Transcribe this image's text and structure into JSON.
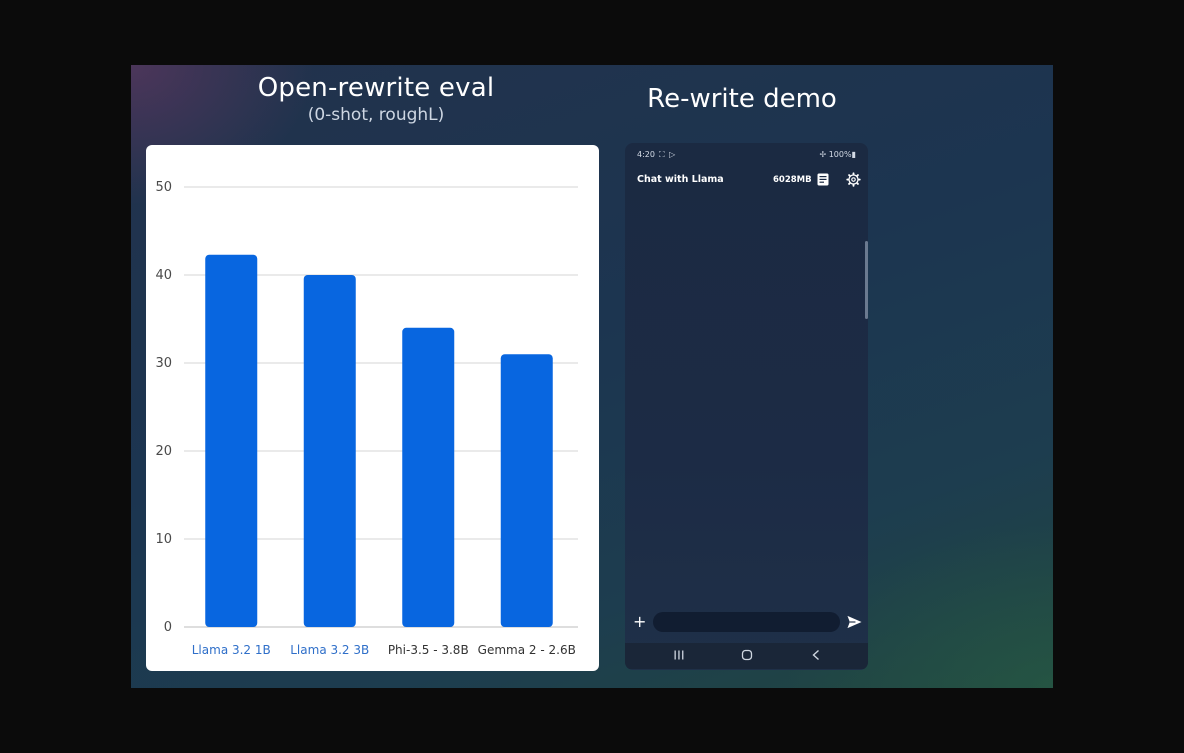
{
  "slide": {
    "left_title": "Open-rewrite eval",
    "left_subtitle": "(0-shot, roughL)",
    "right_title": "Re-write demo"
  },
  "chart_data": {
    "type": "bar",
    "title": "Open-rewrite eval",
    "subtitle": "(0-shot, roughL)",
    "categories": [
      "Llama 3.2 1B",
      "Llama 3.2 3B",
      "Phi-3.5 - 3.8B",
      "Gemma 2 - 2.6B"
    ],
    "values": [
      42.3,
      40.0,
      34.0,
      31.0
    ],
    "ylim": [
      0,
      50
    ],
    "yticks": [
      0,
      10,
      20,
      30,
      40,
      50
    ],
    "xlabel": "",
    "ylabel": "",
    "grid": true,
    "bar_color": "#0866e0",
    "category_label_colors": [
      "#2f6fc9",
      "#2f6fc9",
      "#333333",
      "#333333"
    ]
  },
  "phone": {
    "status": {
      "time": "4:20",
      "icons": "⛶ ▷",
      "battery": "✢ 100%▮"
    },
    "header": {
      "title": "Chat with Llama",
      "memory": "6028MB"
    },
    "input": {
      "plus": "+",
      "placeholder": ""
    },
    "icons": {
      "doc": "document-icon",
      "settings": "gear-icon",
      "send": "send-icon",
      "nav_recent": "recent-apps-icon",
      "nav_home": "home-icon",
      "nav_back": "back-icon"
    }
  }
}
